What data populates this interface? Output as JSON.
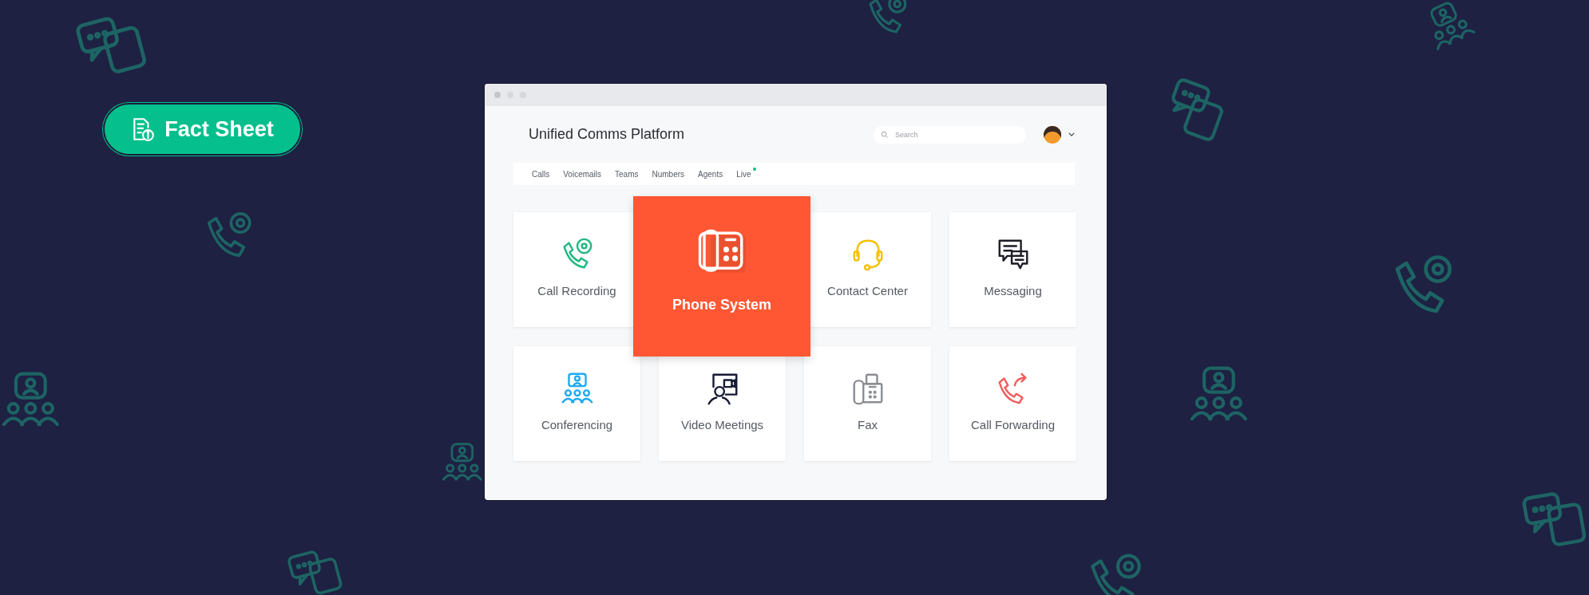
{
  "badge": {
    "label": "Fact Sheet"
  },
  "window": {
    "title": "Unified Comms Platform"
  },
  "search": {
    "placeholder": "Search"
  },
  "tabs": [
    {
      "label": "Calls",
      "dot": false
    },
    {
      "label": "Voicemails",
      "dot": false
    },
    {
      "label": "Teams",
      "dot": false
    },
    {
      "label": "Numbers",
      "dot": false
    },
    {
      "label": "Agents",
      "dot": false
    },
    {
      "label": "Live",
      "dot": true
    }
  ],
  "cards": [
    {
      "label": "Call Recording",
      "kind": "recording",
      "color": "#1db87f",
      "selected": false
    },
    {
      "label": "Phone System",
      "kind": "phone",
      "color": "#ffffff",
      "selected": true
    },
    {
      "label": "Contact Center",
      "kind": "headset",
      "color": "#f5c000",
      "selected": false
    },
    {
      "label": "Messaging",
      "kind": "messaging",
      "color": "#1c1c24",
      "selected": false
    },
    {
      "label": "Conferencing",
      "kind": "conferencing",
      "color": "#1eaaf1",
      "selected": false
    },
    {
      "label": "Video Meetings",
      "kind": "video",
      "color": "#151a33",
      "selected": false
    },
    {
      "label": "Fax",
      "kind": "fax",
      "color": "#8a8d93",
      "selected": false
    },
    {
      "label": "Call Forwarding",
      "kind": "forward",
      "color": "#f25a5a",
      "selected": false
    }
  ]
}
